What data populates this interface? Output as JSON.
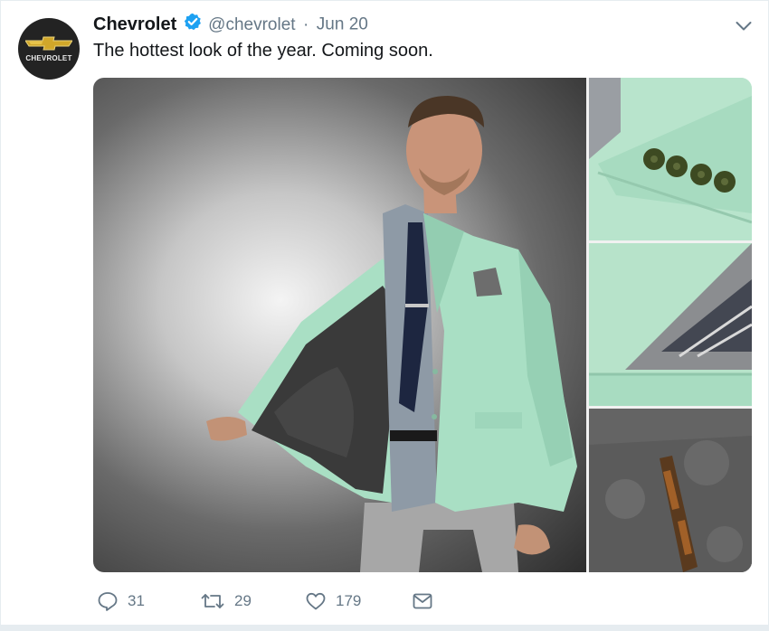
{
  "account": {
    "name": "Chevrolet",
    "handle": "@chevrolet",
    "separator": "·",
    "date": "Jun 20",
    "verified": true,
    "avatar_text": "CHEVROLET",
    "avatar_logo": "chevrolet-bowtie-logo"
  },
  "tweet": {
    "text": "The hottest look of the year. Coming soon."
  },
  "media": {
    "images": [
      {
        "description_name": "man-in-mint-blazer-photo"
      },
      {
        "description_name": "blazer-cuff-buttons-photo"
      },
      {
        "description_name": "pocket-square-photo"
      },
      {
        "description_name": "jacket-lining-pen-photo"
      }
    ]
  },
  "actions": {
    "reply_count": "31",
    "retweet_count": "29",
    "like_count": "179"
  },
  "icons": {
    "caret": "chevron-down-icon",
    "reply": "reply-icon",
    "retweet": "retweet-icon",
    "like": "heart-icon",
    "dm": "envelope-icon",
    "verified": "verified-badge-icon"
  },
  "colors": {
    "text_primary": "#14171a",
    "text_secondary": "#657786",
    "verified_blue": "#1da1f2",
    "jacket_mint": "#a9dfc4",
    "logo_gold": "#d1a72a"
  }
}
